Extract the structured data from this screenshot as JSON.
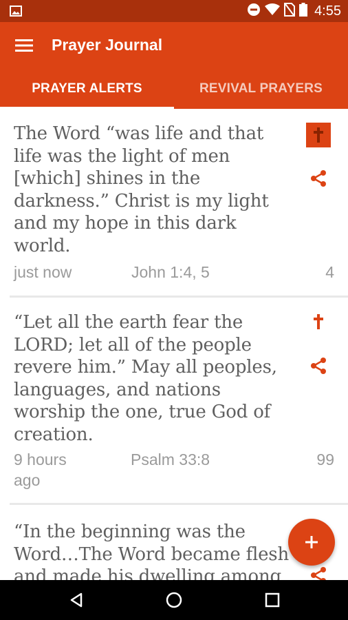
{
  "status_bar": {
    "time": "4:55",
    "icons": [
      "image-icon",
      "do-not-disturb-icon",
      "wifi-icon",
      "no-sim-icon",
      "battery-icon"
    ]
  },
  "app_bar": {
    "title": "Prayer Journal",
    "menu_icon": "hamburger-menu-icon"
  },
  "tabs": [
    {
      "label": "PRAYER ALERTS",
      "selected": true
    },
    {
      "label": "REVIVAL PRAYERS",
      "selected": false
    }
  ],
  "cards": [
    {
      "verse": "The Word “was life and that life was the light of men [which] shines in the darkness.” Christ is my light and my hope in this dark world.",
      "time": "just now",
      "reference": "John 1:4, 5",
      "count": "4",
      "cross_active": true
    },
    {
      "verse": "“Let all the earth fear the LORD; let all of the people revere him.” May all peoples, languages, and nations worship the one, true God of creation.",
      "time": "9 hours ago",
      "reference": "Psalm 33:8",
      "count": "99",
      "cross_active": false
    },
    {
      "verse": "“In the beginning was the Word…The Word became flesh and made his dwelling among"
    }
  ],
  "fab": {
    "label": "+"
  },
  "colors": {
    "primary": "#dc4314",
    "status_bar": "#a8300c",
    "text": "#5f5f5f",
    "meta_text": "#9a9a9a"
  }
}
